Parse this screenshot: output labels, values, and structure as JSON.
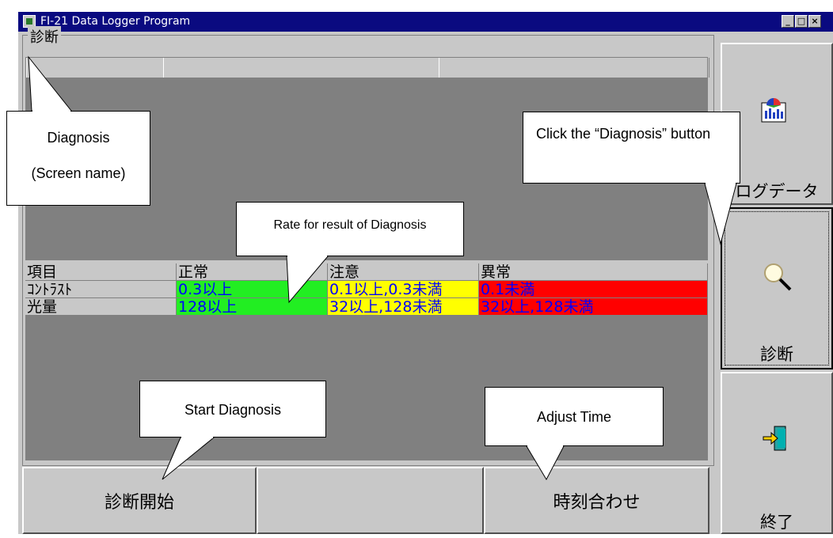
{
  "window": {
    "title": "FI-21 Data Logger Program"
  },
  "group_label": "診断",
  "table": {
    "rows": [
      {
        "cells": [
          "項目",
          "正常",
          "注意",
          "異常"
        ]
      },
      {
        "cells": [
          "ｺﾝﾄﾗｽﾄ",
          "0.3以上",
          "0.1以上,0.3未満",
          "0.1未満"
        ]
      },
      {
        "cells": [
          "光量",
          "128以上",
          "32以上,128未満",
          "32以上,128未満"
        ]
      }
    ]
  },
  "bottom_buttons": {
    "start": "診断開始",
    "time": "時刻合わせ"
  },
  "side_buttons": {
    "logdata": "ログデータ",
    "diagnosis": "診断",
    "exit": "終了"
  },
  "callouts": {
    "screen_name_1": "Diagnosis",
    "screen_name_2": "(Screen name)",
    "rate": "Rate for result of Diagnosis",
    "click_diag": "Click  the  “Diagnosis” button",
    "start": "Start Diagnosis",
    "adjust": "Adjust Time"
  },
  "colors": {
    "title_bar": "#0a0a80",
    "normal": "#22ee22",
    "caution": "#ffff00",
    "abnormal": "#ff0000"
  }
}
